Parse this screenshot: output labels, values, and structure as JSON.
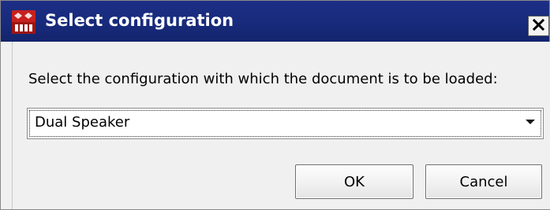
{
  "window": {
    "title": "Select configuration",
    "app_icon": "solidworks-2017-icon",
    "close_icon": "close-x-icon"
  },
  "dialog": {
    "prompt": "Select the configuration with which the document is to be loaded:",
    "configuration_select": {
      "selected_value": "Dual Speaker"
    },
    "buttons": {
      "ok_label": "OK",
      "cancel_label": "Cancel"
    }
  },
  "colors": {
    "titlebar": "#172a7a",
    "dialog_background": "#f0f0f0",
    "icon_red": "#c8201e"
  }
}
